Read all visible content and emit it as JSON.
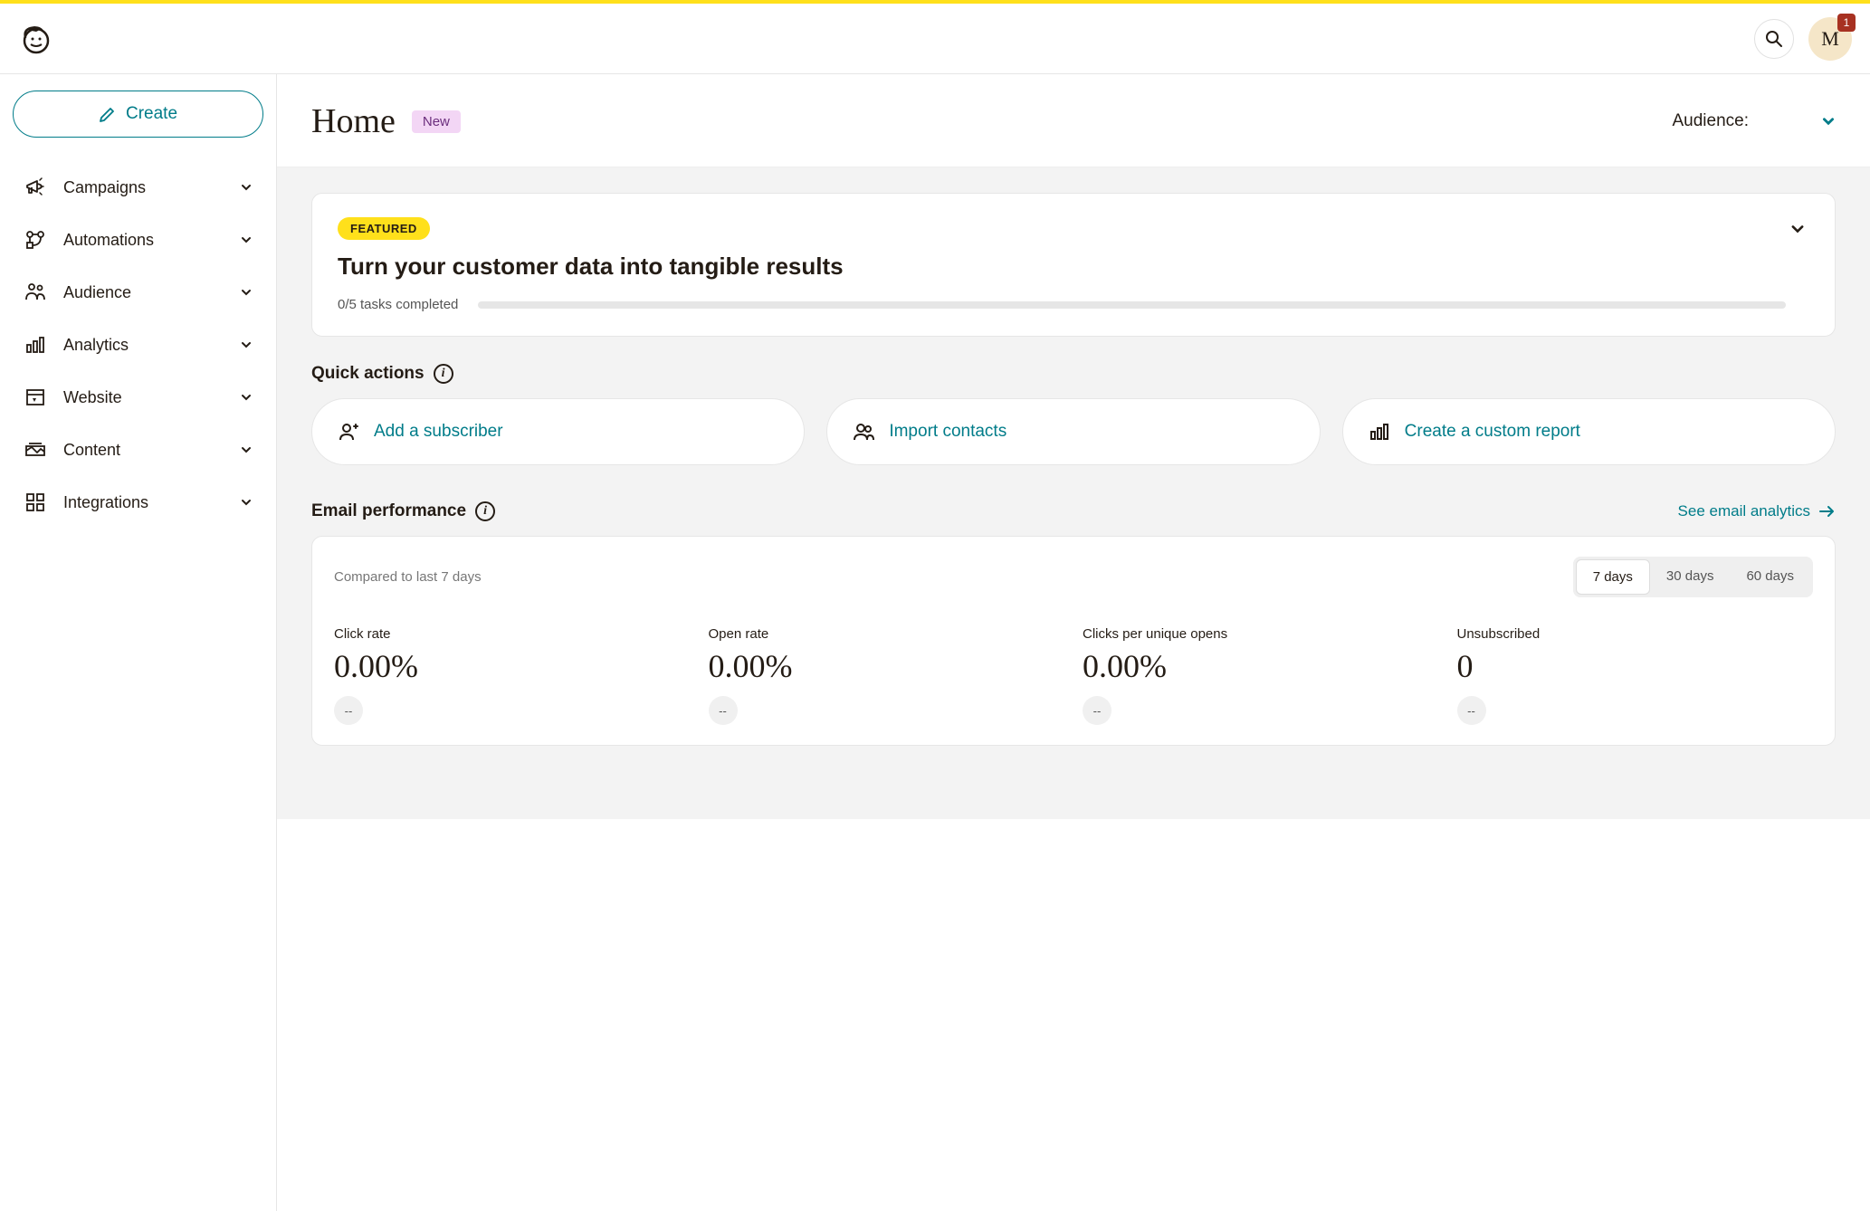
{
  "topbar": {
    "avatar_initial": "M",
    "notification_count": "1"
  },
  "sidebar": {
    "create_label": "Create",
    "items": [
      {
        "label": "Campaigns"
      },
      {
        "label": "Automations"
      },
      {
        "label": "Audience"
      },
      {
        "label": "Analytics"
      },
      {
        "label": "Website"
      },
      {
        "label": "Content"
      },
      {
        "label": "Integrations"
      }
    ]
  },
  "header": {
    "title": "Home",
    "new_badge": "New",
    "audience_label": "Audience:"
  },
  "featured": {
    "badge": "FEATURED",
    "title": "Turn your customer data into tangible results",
    "progress_text": "0/5 tasks completed"
  },
  "quick_actions": {
    "title": "Quick actions",
    "items": [
      {
        "label": "Add a subscriber"
      },
      {
        "label": "Import contacts"
      },
      {
        "label": "Create a custom report"
      }
    ]
  },
  "email_perf": {
    "title": "Email performance",
    "see_link": "See email analytics",
    "compared_text": "Compared to last 7 days",
    "tabs": [
      "7 days",
      "30 days",
      "60 days"
    ],
    "metrics": [
      {
        "label": "Click rate",
        "value": "0.00%",
        "delta": "--"
      },
      {
        "label": "Open rate",
        "value": "0.00%",
        "delta": "--"
      },
      {
        "label": "Clicks per unique opens",
        "value": "0.00%",
        "delta": "--"
      },
      {
        "label": "Unsubscribed",
        "value": "0",
        "delta": "--"
      }
    ]
  }
}
